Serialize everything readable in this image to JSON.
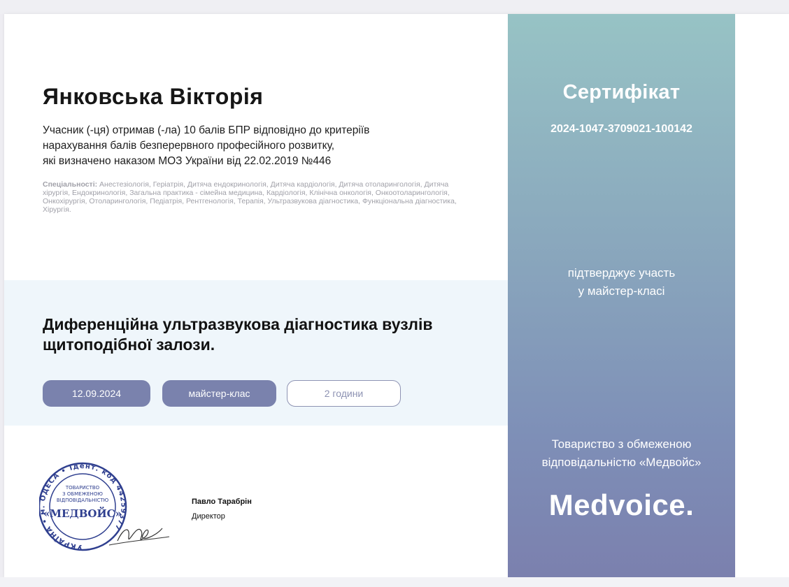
{
  "participant": {
    "name": "Янковська Вікторія",
    "statement_lines": [
      "Учасник (-ця) отримав (-ла) 10 балів БПР відповідно до критеріїв",
      "нарахування балів безперервного професійного розвитку,",
      "які визначено наказом МОЗ України від 22.02.2019 №446"
    ],
    "specialties_label": "Спеціальності:",
    "specialties_text": " Анестезіологія, Геріатрія, Дитяча ендокринологія, Дитяча кардіологія, Дитяча отоларингологія, Дитяча хірургія, Ендокринологія, Загальна практика - сімейна медицина, Кардіологія, Клінічна онкологія, Онкоотоларингологія, Онкохірургія, Отоларингологія, Педіатрія, Рентгенологія, Терапія, Ультразвукова діагностика, Функціональна діагностика, Хірургія."
  },
  "course": {
    "title": "Диференційна ультразвукова діагностика вузлів щитоподібної залози.",
    "date": "12.09.2024",
    "format": "майстер-клас",
    "duration": "2 години"
  },
  "signature": {
    "name": "Павло Тарабрін",
    "role": "Директор"
  },
  "stamp": {
    "outer_text": "УКРАЇНА • м. ОДЕСА • Ідент. код 44259377",
    "inner_lines": [
      "ТОВАРИСТВО",
      "З ОБМЕЖЕНОЮ",
      "ВІДПОВІДАЛЬНІСТЮ"
    ],
    "center_text": "«МЕДВОЙС»"
  },
  "certificate": {
    "title": "Сертифікат",
    "number": "2024-1047-3709021-100142",
    "confirms_lines": [
      "підтверджує участь",
      "у майстер-класі"
    ],
    "company_lines": [
      "Товариство з обмеженою",
      "відповідальністю «Медвойс»"
    ],
    "logo": "Medvoice."
  },
  "colors": {
    "pill": "#7a82ad",
    "band": "#eff6fb",
    "panel_top": "#97c3c5",
    "panel_bottom": "#7b80ae",
    "stamp": "#2f3f8f"
  }
}
